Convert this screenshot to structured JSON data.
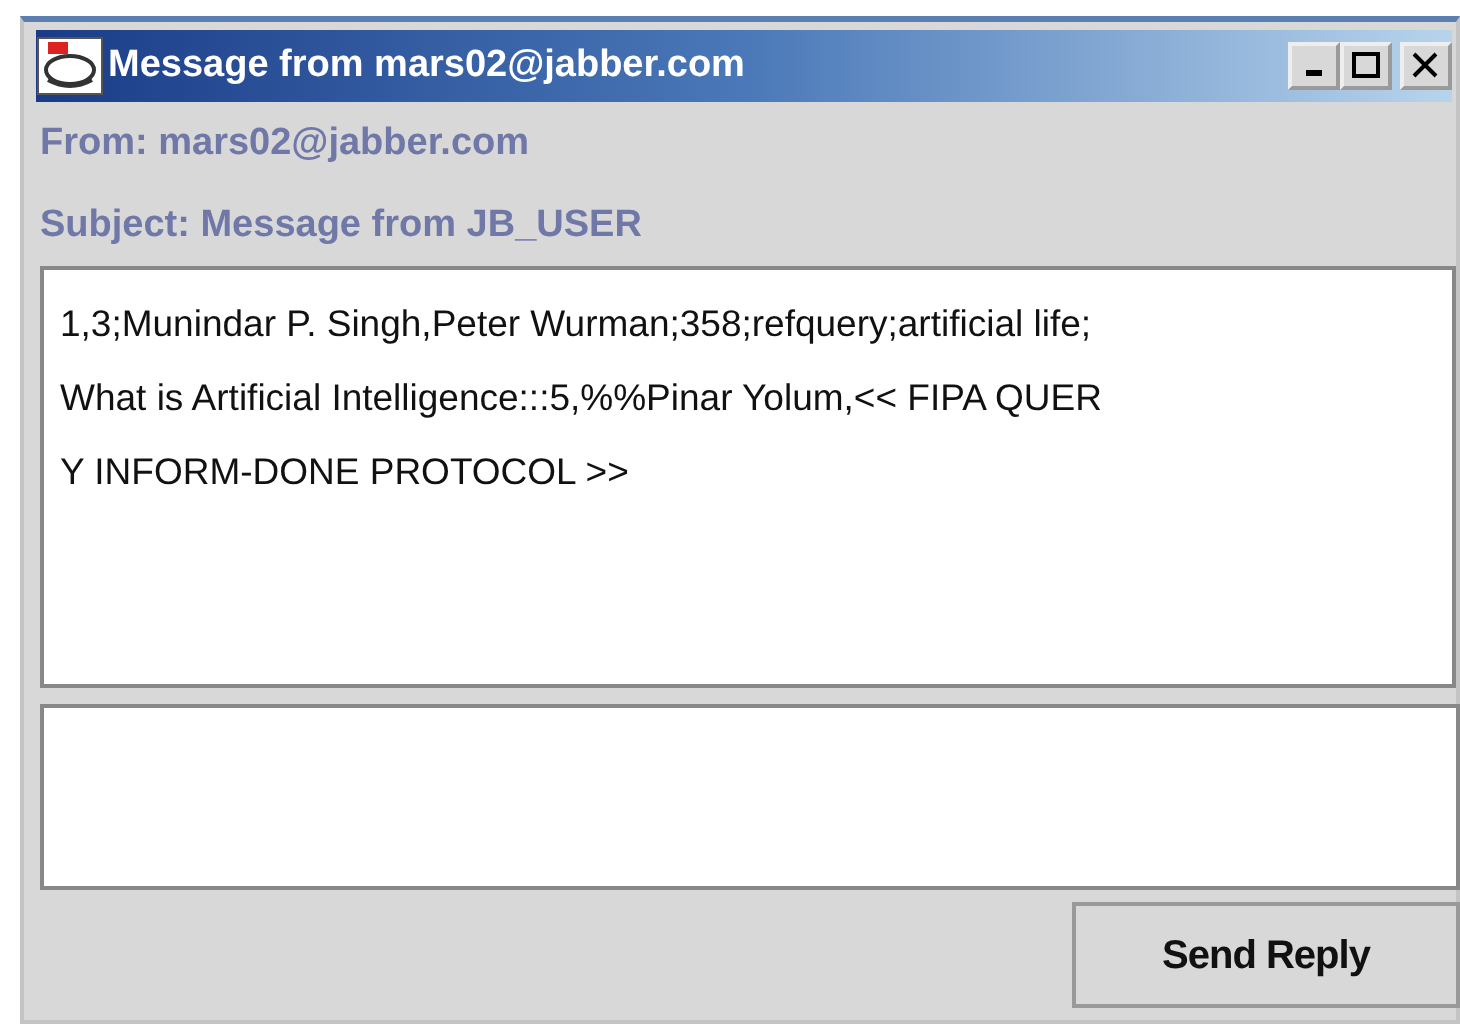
{
  "window": {
    "title": "Message from mars02@jabber.com"
  },
  "from": "From: mars02@jabber.com",
  "subject": "Subject: Message from JB_USER",
  "message": {
    "lines": [
      "1,3;Munindar P. Singh,Peter Wurman;358;refquery;artificial life;",
      "What is Artificial Intelligence:::5,%%Pinar Yolum,<< FIPA QUER",
      "Y INFORM-DONE PROTOCOL >>"
    ]
  },
  "buttons": [
    "Send Reply"
  ]
}
